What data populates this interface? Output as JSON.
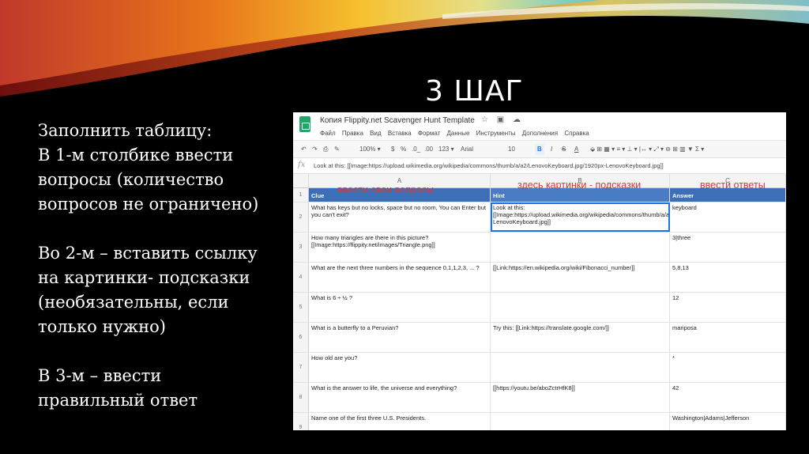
{
  "slide": {
    "title": "3 ШАГ",
    "instructions": [
      [
        "Заполнить таблицу:",
        "В 1-м столбике ввести",
        "вопросы (количество",
        "вопросов не ограничено)"
      ],
      [
        "Во 2-м – вставить ссылку",
        "на картинки- подсказки",
        "(необязательны, если",
        "только нужно)"
      ],
      [
        "В 3-м – ввести",
        "правильный ответ"
      ]
    ]
  },
  "sheet": {
    "doc_title": "Копия Flippity.net Scavenger Hunt Template",
    "doc_icons": "☆ ▣ ☁",
    "menu": [
      "Файл",
      "Правка",
      "Вид",
      "Вставка",
      "Формат",
      "Данные",
      "Инструменты",
      "Дополнения",
      "Справка"
    ],
    "toolbar": {
      "undo": "↶",
      "redo": "↷",
      "print": "⎙",
      "paint": "✎",
      "zoom": "100% ▾",
      "currency": "$",
      "percent": "%",
      "dec0": ".0_",
      "dec00": ".00",
      "format": "123 ▾",
      "font": "Arial",
      "size": "10",
      "bold": "B",
      "italic": "I",
      "strike": "S",
      "color": "A",
      "more": "⬙  ⊞  ▦ ▾   ≡ ▾  ⊥ ▾  |↔ ▾  ⤢ ▾   ⊖  ⊞  ▥  ▼  Σ ▾"
    },
    "formula_label": "fx",
    "formula": "Look at this: [[Image:https://upload.wikimedia.org/wikipedia/commons/thumb/a/a2/LenovoKeyboard.jpg/1920px-LenovoKeyboard.jpg]]",
    "column_letters": [
      "A",
      "B",
      "C"
    ],
    "headers": {
      "row": "1",
      "clue": "Clue",
      "hint": "Hint",
      "answer": "Answer"
    },
    "rows": [
      {
        "n": "2",
        "clue": "What has keys but no locks, space but no room, You can Enter but you can't exit?",
        "hint": "Look at this: [[Image:https://upload.wikimedia.org/wikipedia/commons/thumb/a/a2/LenovoKeyboard.jpg/1920px-LenovoKeyboard.jpg]]",
        "answer": "keyboard"
      },
      {
        "n": "3",
        "clue": "How many triangles are there in this picture? [[Image:https://flippity.net/images/Triangle.png]]",
        "hint": "",
        "answer": "3|three"
      },
      {
        "n": "4",
        "clue": "What are the next three numbers in the sequence 0,1,1,2,3, ... ?",
        "hint": "[[Link:https://en.wikipedia.org/wiki/Fibonacci_number]]",
        "answer": "5,8,13"
      },
      {
        "n": "5",
        "clue": "What is 6 ÷ ½ ?",
        "hint": "",
        "answer": "12"
      },
      {
        "n": "6",
        "clue": "What is a butterfly to a Peruvian?",
        "hint": "Try this: [[Link:https://translate.google.com/]]",
        "answer": "mariposa"
      },
      {
        "n": "7",
        "clue": "How old are you?",
        "hint": "",
        "answer": "*"
      },
      {
        "n": "8",
        "clue": "What is the answer to life, the universe and everything?",
        "hint": "[[https://youtu.be/aboZctrHfK8]]",
        "answer": "42"
      },
      {
        "n": "9",
        "clue": "Name one of the first three U.S. Presidents.",
        "hint": "",
        "answer": "Washington|Adams|Jefferson"
      }
    ]
  },
  "annotations": {
    "questions": "ввести свои вопросы",
    "hints": "здесь картинки - подсказки",
    "answers": "ввести ответы"
  },
  "colors": {
    "background": "#000000",
    "header_fill": "#3d6fb6",
    "annotation": "#e0342c",
    "selection": "#1a73e8",
    "sheets_green": "#23a566"
  }
}
